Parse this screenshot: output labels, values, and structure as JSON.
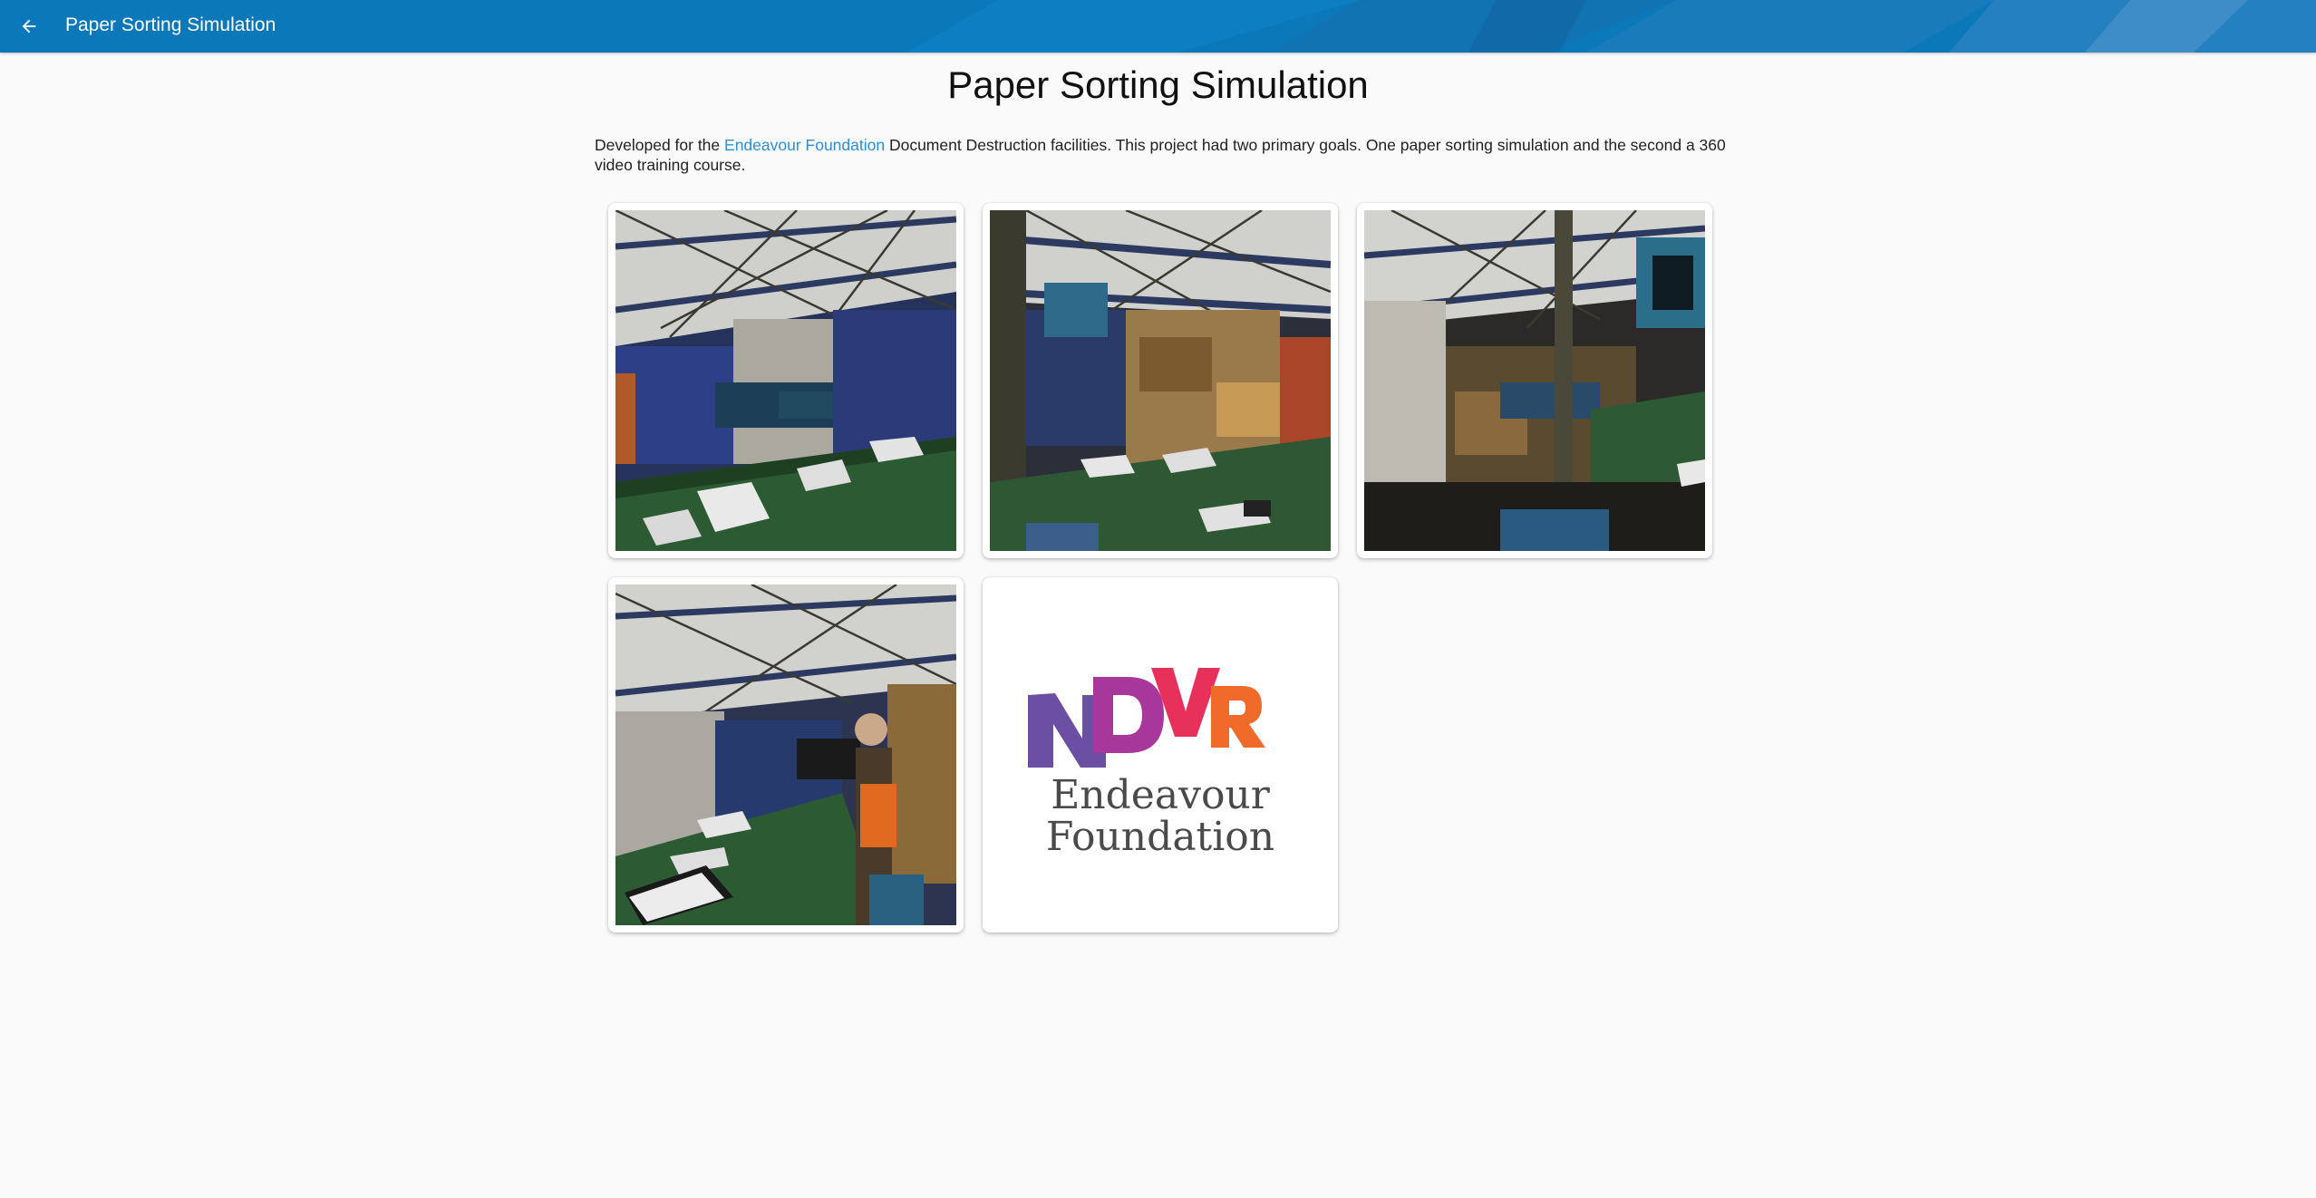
{
  "appbar": {
    "title": "Paper Sorting Simulation",
    "back_icon": "arrow-back-icon",
    "color": "#0a78b9"
  },
  "page": {
    "title": "Paper Sorting Simulation",
    "intro_prefix": "Developed for the ",
    "intro_link": "Endeavour Foundation",
    "intro_suffix": " Document Destruction facilities. This project had two primary goals. One paper sorting simulation and the second a 360 video training course.",
    "link_color": "#2b8fd6"
  },
  "gallery": {
    "items": [
      {
        "name": "Simulation screenshot 1"
      },
      {
        "name": "Simulation screenshot 2"
      },
      {
        "name": "Simulation screenshot 3"
      },
      {
        "name": "Simulation screenshot 4"
      },
      {
        "name": "Endeavour Foundation logo"
      }
    ],
    "logo": {
      "mark_letters": [
        "N",
        "D",
        "V",
        "R"
      ],
      "mark_colors": [
        "#6a4fa3",
        "#a8379b",
        "#e8315a",
        "#f06a2a"
      ],
      "text_line1": "Endeavour",
      "text_line2": "Foundation",
      "text_color": "#4a4a4a"
    }
  }
}
